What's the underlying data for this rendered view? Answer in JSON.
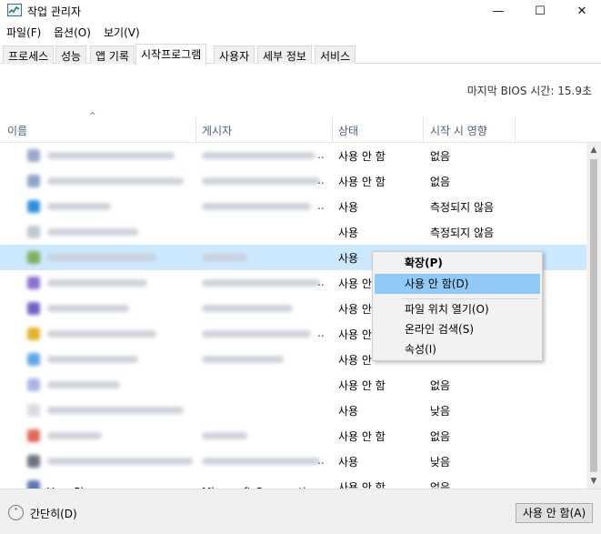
{
  "window": {
    "title": "작업 관리자",
    "minimize_glyph": "—",
    "maximize_glyph": "☐",
    "close_glyph": "✕"
  },
  "menu": [
    "파일(F)",
    "옵션(O)",
    "보기(V)"
  ],
  "tabs": [
    "프로세스",
    "성능",
    "앱 기록",
    "시작프로그램",
    "사용자",
    "세부 정보",
    "서비스"
  ],
  "active_tab": "시작프로그램",
  "bios": {
    "label": "마지막 BIOS 시간:",
    "value": "15.9초"
  },
  "columns": {
    "name": "이름",
    "publisher": "게시자",
    "status": "상태",
    "impact": "시작 시 영향"
  },
  "rows": [
    {
      "status": "사용 안 함",
      "impact": "없음"
    },
    {
      "status": "사용 안 함",
      "impact": "없음"
    },
    {
      "status": "사용",
      "impact": "측정되지 않음"
    },
    {
      "status": "사용",
      "impact": "측정되지 않음"
    },
    {
      "status": "사용",
      "impact": ""
    },
    {
      "status": "사용 안",
      "impact": ""
    },
    {
      "status": "사용 안",
      "impact": ""
    },
    {
      "status": "사용 안",
      "impact": ""
    },
    {
      "status": "사용 안",
      "impact": ""
    },
    {
      "status": "사용 안 함",
      "impact": "없음"
    },
    {
      "status": "사용",
      "impact": "낮음"
    },
    {
      "status": "사용 안 함",
      "impact": "없음"
    },
    {
      "status": "사용",
      "impact": "낮음"
    },
    {
      "name": "Your Phone",
      "publisher": "Microsoft Corporation",
      "status": "사용 안 함",
      "impact": "없음"
    }
  ],
  "row_icon_colors": [
    "#9aa9c8",
    "#8fa3c9",
    "#2f8fe0",
    "#c0c7d2",
    "#7fb25a",
    "#8c6fd0",
    "#7062c4",
    "#e0b32a",
    "#63a6e6",
    "#a8b4e6",
    "#d9dce2",
    "#e0675a",
    "#6b7480",
    "#5a78b0"
  ],
  "context_menu": {
    "items": [
      {
        "label": "확장(P)",
        "bold": true
      },
      {
        "label": "사용 안 함(D)",
        "hover": true
      },
      {
        "label": "파일 위치 열기(O)"
      },
      {
        "label": "온라인 검색(S)"
      },
      {
        "label": "속성(I)"
      }
    ]
  },
  "footer": {
    "fewer_details": "간단히(D)",
    "disable_button": "사용 안 함(A)"
  }
}
